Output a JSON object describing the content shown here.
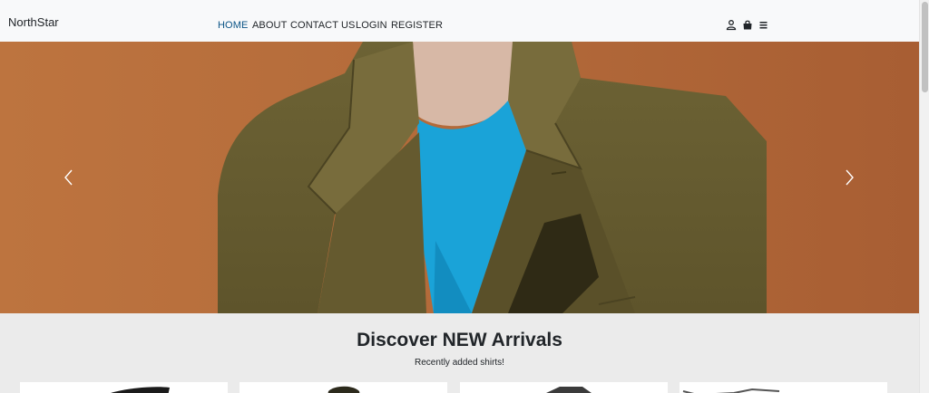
{
  "brand": "NorthStar",
  "nav": {
    "home": "HOME",
    "about": "ABOUT",
    "contact": "CONTACT US",
    "login": "LOGIN",
    "register": "REGISTER"
  },
  "icons": {
    "account": "user-icon",
    "cart": "shopping-bag-icon",
    "menu": "hamburger-menu-icon",
    "prev": "chevron-left-icon",
    "next": "chevron-right-icon"
  },
  "colors": {
    "nav_active": "#0b5486",
    "carousel_backdrop": "#b56a3a",
    "jacket": "#6b6033",
    "shirt": "#1aa3d8"
  },
  "new_arrivals": {
    "title": "Discover NEW Arrivals",
    "subtitle": "Recently added shirts!"
  }
}
